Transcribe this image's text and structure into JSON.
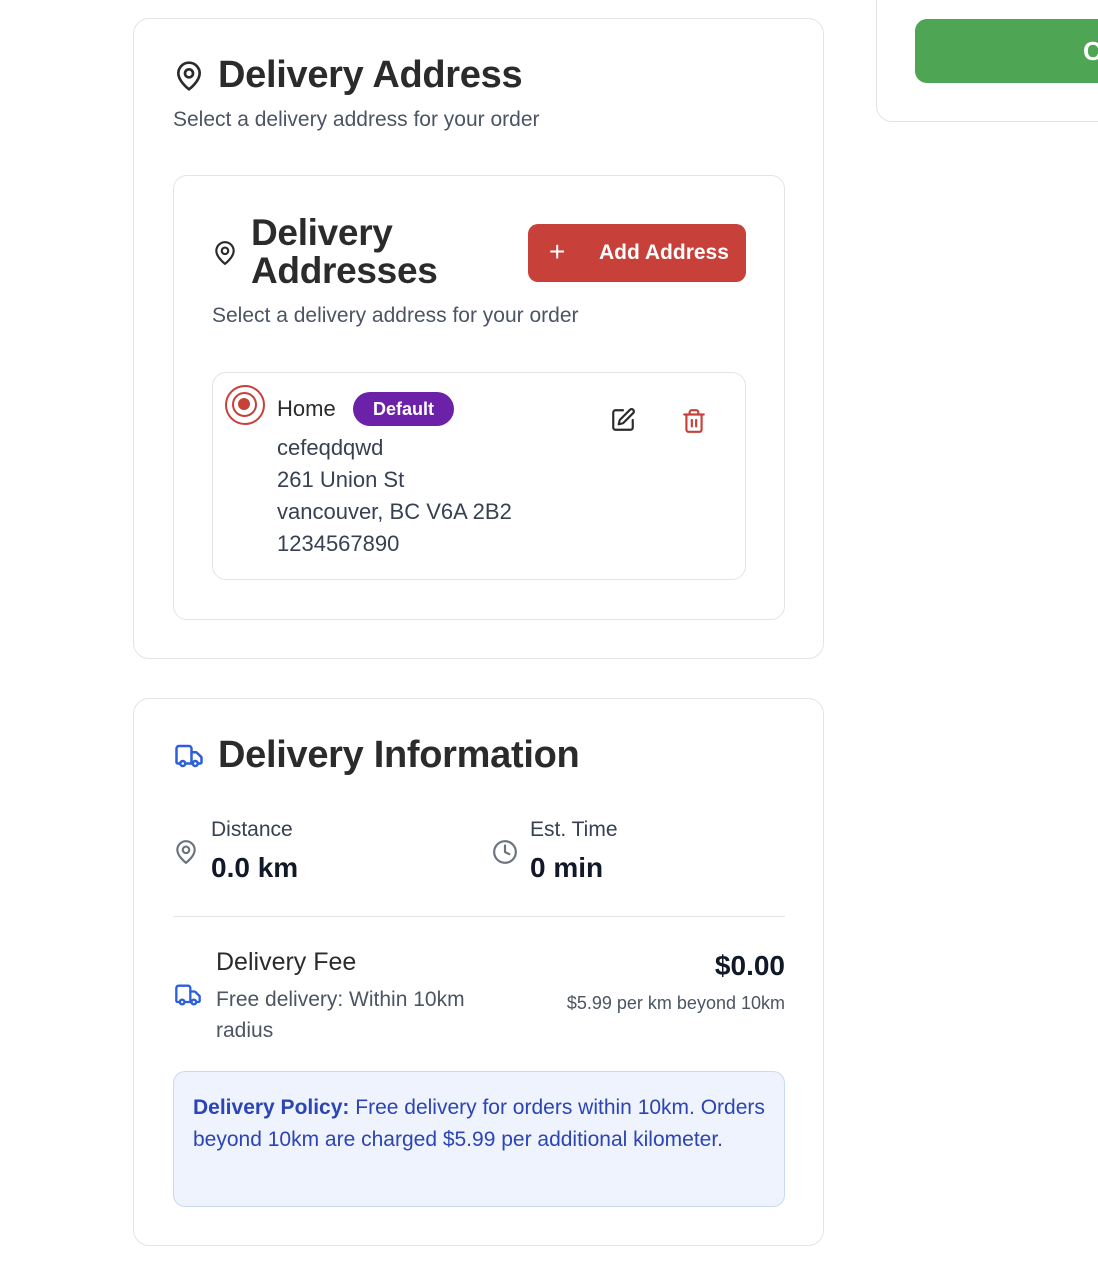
{
  "side_panel": {
    "checkout_button_label": "C"
  },
  "address_section": {
    "title": "Delivery Address",
    "subtitle": "Select a delivery address for your order",
    "inner": {
      "title": "Delivery Addresses",
      "subtitle": "Select a delivery address for your order",
      "add_button_label": "Add Address",
      "add_button_icon": "plus-icon",
      "addresses": [
        {
          "name": "Home",
          "badge": "Default",
          "selected": true,
          "line1": "cefeqdqwd",
          "line2": "261 Union St",
          "line3": "vancouver, BC V6A 2B2",
          "phone": "1234567890"
        }
      ]
    }
  },
  "info_section": {
    "title": "Delivery Information",
    "distance_label": "Distance",
    "distance_value": "0.0 km",
    "time_label": "Est. Time",
    "time_value": "0 min",
    "fee_title": "Delivery Fee",
    "fee_desc": "Free delivery: Within 10km radius",
    "fee_amount": "$0.00",
    "fee_note": "$5.99 per km beyond 10km",
    "policy_label": "Delivery Policy:",
    "policy_text": " Free delivery for orders within 10km. Orders beyond 10km are charged $5.99 per additional kilometer."
  },
  "colors": {
    "accent_red": "#c8403a",
    "badge_purple": "#6b21a8",
    "checkout_green": "#4ea553",
    "info_blue": "#2c44b4"
  }
}
